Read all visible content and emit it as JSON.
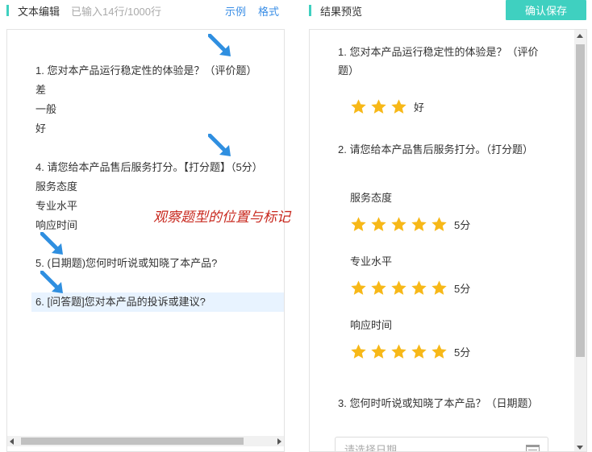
{
  "header_left": {
    "title": "文本编辑",
    "count": "已输入14行/1000行",
    "link_example": "示例",
    "link_format": "格式"
  },
  "header_right": {
    "title": "结果预览",
    "save_button": "确认保存"
  },
  "editor": {
    "lines": [
      "1. 您对本产品运行稳定性的体验是？（评价题）",
      "差",
      "一般",
      "好",
      "4. 请您给本产品售后服务打分。【打分题】（5分）",
      "服务态度",
      "专业水平",
      "响应时间",
      "5. (日期题)您何时听说或知晓了本产品?",
      "6. [问答题]您对本产品的投诉或建议?"
    ],
    "annotation": "观察题型的位置与标记"
  },
  "preview": {
    "q1": {
      "title": "1. 您对本产品运行稳定性的体验是？（评价题）",
      "rating": 3,
      "rating_label": "好"
    },
    "q2": {
      "title": "2. 请您给本产品售后服务打分。（打分题）",
      "items": [
        {
          "label": "服务态度",
          "score": 5,
          "score_label": "5分"
        },
        {
          "label": "专业水平",
          "score": 5,
          "score_label": "5分"
        },
        {
          "label": "响应时间",
          "score": 5,
          "score_label": "5分"
        }
      ]
    },
    "q3": {
      "title": "3. 您何时听说或知晓了本产品？（日期题）",
      "placeholder": "请选择日期"
    }
  },
  "colors": {
    "accent": "#3fd0c0",
    "link": "#3a8ee6",
    "star": "#f7b818",
    "annotation": "#c8281e",
    "arrow": "#2f8fe0",
    "active_line": "#e8f3ff"
  }
}
